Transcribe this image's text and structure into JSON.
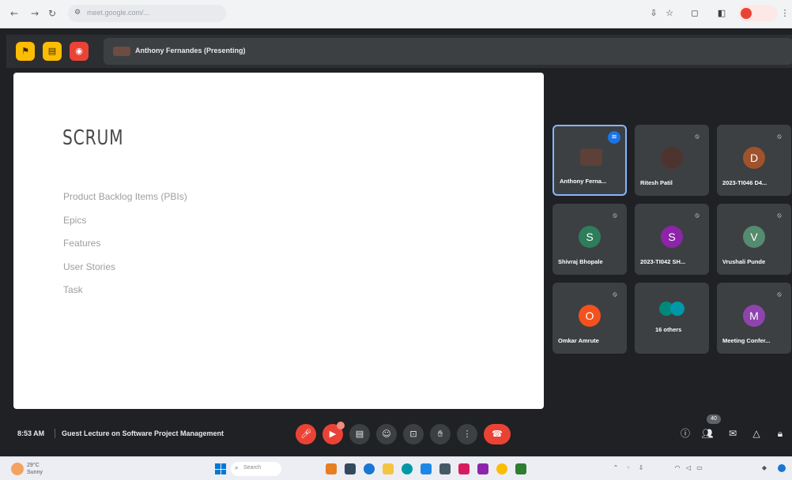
{
  "browser": {
    "url": "meet.google.com/..."
  },
  "meet": {
    "presenting_label": "Anthony Fernandes (Presenting)",
    "meeting_time": "8:53 AM",
    "meeting_title": "Guest Lecture on Software Project Management",
    "people_count": "40"
  },
  "slide": {
    "title": "SCRUM",
    "items": [
      "Product Backlog Items (PBIs)",
      "Epics",
      "Features",
      "User Stories",
      "Task"
    ]
  },
  "participants": [
    {
      "name": "Anthony Ferna...",
      "avatar": "photo",
      "speaking": true
    },
    {
      "name": "Ritesh Patil",
      "avatar": "photo"
    },
    {
      "name": "2023-TI046 D4...",
      "initial": "D",
      "color": "#a0522d"
    },
    {
      "name": "Shivraj Bhopale",
      "initial": "S",
      "color": "#2e7d5b"
    },
    {
      "name": "2023-TI042 SH...",
      "initial": "S",
      "color": "#8e24aa"
    },
    {
      "name": "Vrushali Punde",
      "initial": "V",
      "color": "#558b6e"
    },
    {
      "name": "Omkar Amrute",
      "initial": "O",
      "color": "#f4511e"
    },
    {
      "name": "16 others",
      "initial": "",
      "color": "#00897b"
    },
    {
      "name": "Meeting Confer...",
      "initial": "M",
      "color": "#8e44ad"
    }
  ],
  "taskbar": {
    "weather_temp": "29°C",
    "weather_desc": "Sunny",
    "search_placeholder": "Search"
  },
  "colors": {
    "accent": "#1a73e8",
    "leave": "#ea4335",
    "host_controls": "#fbbc04"
  }
}
